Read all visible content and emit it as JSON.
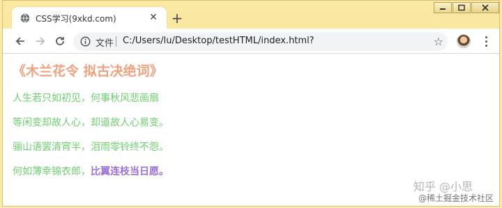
{
  "tab": {
    "title": "CSS学习(9xkd.com)",
    "close_glyph": "✕",
    "newtab_glyph": "+"
  },
  "toolbar": {
    "file_label": "文件",
    "url": "C:/Users/lu/Desktop/testHTML/index.html?",
    "star_glyph": "☆"
  },
  "content": {
    "title": "《木兰花令 拟古决绝词》",
    "lines": [
      "人生若只如初见，何事秋风悲画扇",
      "等闲变却故人心，却道故人心易变。",
      "骊山语罢清宵半，泪雨零铃终不怨。"
    ],
    "last_line": {
      "prefix": "何如薄幸锦衣郎，",
      "highlight": "比翼连枝当日愿。"
    }
  },
  "watermark": {
    "line1": "知乎 @小思",
    "line2": "@稀土掘金技术社区"
  },
  "colors": {
    "title": "#f0a27e",
    "lines": "#6ccf6c",
    "highlight": "#9b72d8",
    "frame": "#fae9a2"
  },
  "icons": [
    "globe-icon",
    "close-icon",
    "plus-icon",
    "minimize-icon",
    "maximize-icon",
    "window-close-icon",
    "back-arrow-icon",
    "forward-arrow-icon",
    "reload-icon",
    "info-icon",
    "star-icon",
    "avatar",
    "kebab-menu-icon"
  ]
}
